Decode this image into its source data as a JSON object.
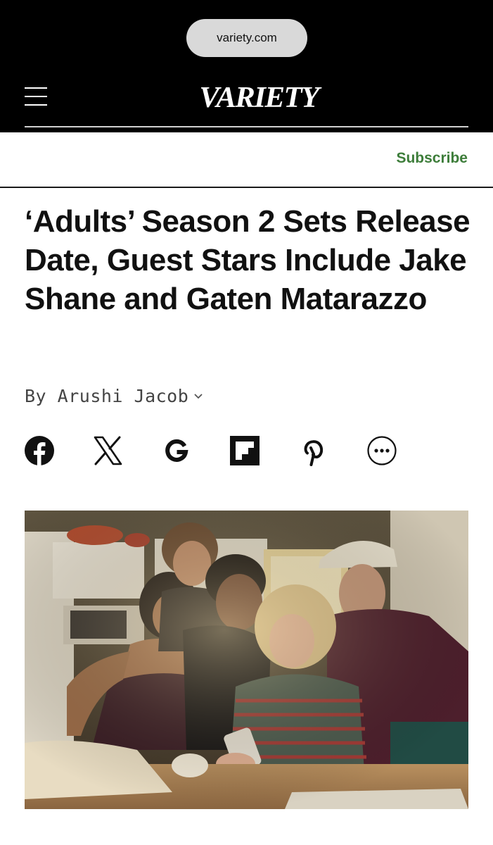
{
  "browser": {
    "url": "variety.com"
  },
  "header": {
    "logo_text": "VARIETY",
    "subscribe_label": "Subscribe",
    "accent_color": "#3d7d3a"
  },
  "article": {
    "headline": "‘Adults’ Season 2 Sets Release Date, Guest Stars Include Jake Shane and Gaten Matarazzo",
    "byline_prefix": "By",
    "author": "Arushi Jacob"
  },
  "share_icons": [
    "facebook-icon",
    "x-icon",
    "google-icon",
    "flipboard-icon",
    "pinterest-icon",
    "more-icon"
  ]
}
